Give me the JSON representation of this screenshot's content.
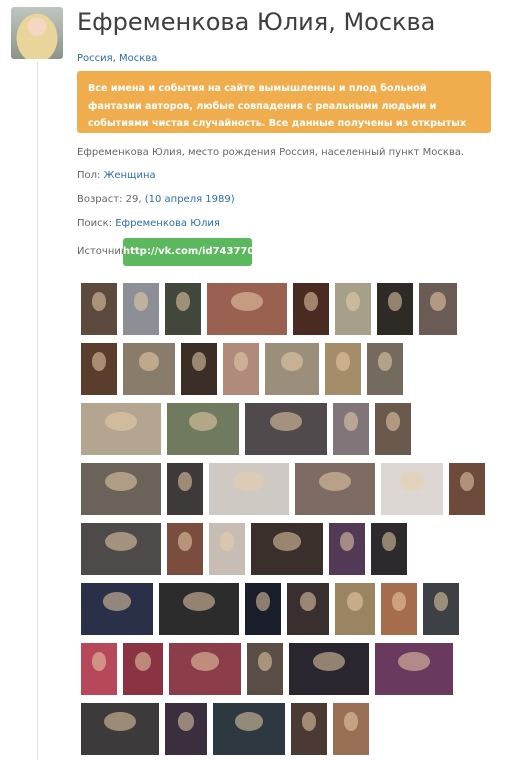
{
  "profile": {
    "title": "Ефременкова Юлия, Москва",
    "country": "Россия",
    "separator": ",",
    "city": "Москва"
  },
  "alert": {
    "text": "Все имена и события на сайте вымышленны и плод больной фантазии авторов, любые совпадения с реальными людьми и событиями чистая случайность. Все данные получены из открытых интернет источников."
  },
  "info": {
    "description": "Ефременкова Юлия, место рождения Россия, населенный пункт Москва.",
    "gender_label": "Пол:",
    "gender_value": "Женщина",
    "age_label": "Возраст: 29,",
    "birth_date": "(10 апреля 1989)",
    "search_label": "Поиск:",
    "search_value": "Ефременкова Юлия",
    "source_label": "Источник:",
    "source_link": "http://vk.com/id743770"
  },
  "colors": {
    "alert": "#f0ad4e",
    "source_button": "#5cb85c",
    "link": "#2a6db0"
  },
  "photos": [
    "#5b4a3d",
    "#8d8f96",
    "#41473a",
    "#9a6150",
    "#4a2b22",
    "#a6a08a",
    "#2e2b27",
    "#6b5b55",
    "#5a3d2c",
    "#8a7c6a",
    "#3a2e26",
    "#b08a7a",
    "#9b8f7c",
    "#a58d6a",
    "#746b5e",
    "#b3a58f",
    "#6f7a5f",
    "#514a4c",
    "#80767a",
    "#6a5a4d",
    "#6b6359",
    "#3e3a39",
    "#cfc9c4",
    "#7e6b63",
    "#dcd7d3",
    "#6d4a3c",
    "#4d4a49",
    "#7a4d3e",
    "#c7bdb5",
    "#3a2f2a",
    "#523a56",
    "#2c2a2c",
    "#2a3047",
    "#2c2c2d",
    "#1a1e2a",
    "#3a2f2f",
    "#9b8462",
    "#a56d4b",
    "#3d4044",
    "#b7475a",
    "#8a3443",
    "#8c3d4a",
    "#5a4d45",
    "#2a2630",
    "#6a3a5e",
    "#3c3a3a",
    "#3a2e3f",
    "#2e3840",
    "#4a3a33",
    "#9a6e55",
    "#b8a99a",
    "#c2b7ad"
  ]
}
